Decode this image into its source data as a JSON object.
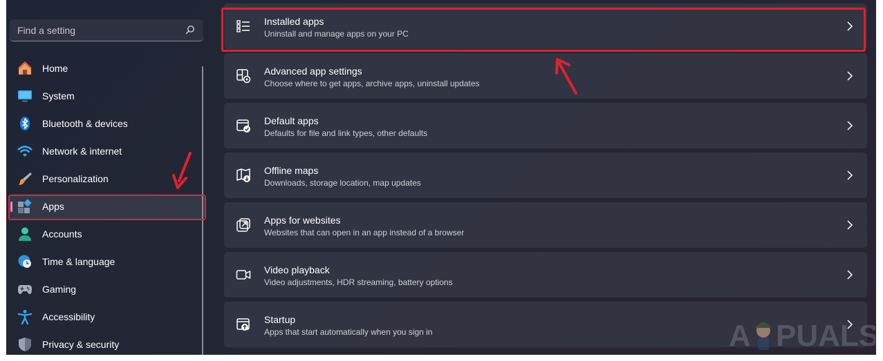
{
  "search": {
    "placeholder": "Find a setting",
    "icon": "search-icon"
  },
  "sidebar": {
    "items": [
      {
        "label": "Home",
        "icon": "home-icon"
      },
      {
        "label": "System",
        "icon": "monitor-icon"
      },
      {
        "label": "Bluetooth & devices",
        "icon": "bluetooth-icon"
      },
      {
        "label": "Network & internet",
        "icon": "wifi-icon"
      },
      {
        "label": "Personalization",
        "icon": "brush-icon"
      },
      {
        "label": "Apps",
        "icon": "apps-icon",
        "selected": true
      },
      {
        "label": "Accounts",
        "icon": "person-icon"
      },
      {
        "label": "Time & language",
        "icon": "globe-clock-icon"
      },
      {
        "label": "Gaming",
        "icon": "gamepad-icon"
      },
      {
        "label": "Accessibility",
        "icon": "accessibility-icon"
      },
      {
        "label": "Privacy & security",
        "icon": "shield-icon"
      }
    ]
  },
  "main": {
    "cards": [
      {
        "title": "Installed apps",
        "subtitle": "Uninstall and manage apps on your PC",
        "icon": "list-icon"
      },
      {
        "title": "Advanced app settings",
        "subtitle": "Choose where to get apps, archive apps, uninstall updates",
        "icon": "app-settings-icon"
      },
      {
        "title": "Default apps",
        "subtitle": "Defaults for file and link types, other defaults",
        "icon": "default-apps-icon"
      },
      {
        "title": "Offline maps",
        "subtitle": "Downloads, storage location, map updates",
        "icon": "map-icon"
      },
      {
        "title": "Apps for websites",
        "subtitle": "Websites that can open in an app instead of a browser",
        "icon": "open-link-icon"
      },
      {
        "title": "Video playback",
        "subtitle": "Video adjustments, HDR streaming, battery options",
        "icon": "video-icon"
      },
      {
        "title": "Startup",
        "subtitle": "Apps that start automatically when you sign in",
        "icon": "startup-icon"
      }
    ]
  },
  "annotations": {
    "highlight_color": "#e0222c"
  },
  "watermark": {
    "text": "APPUALS"
  },
  "colors": {
    "accent": "#e78ad0",
    "background": "#232635",
    "card": "#34374a"
  }
}
